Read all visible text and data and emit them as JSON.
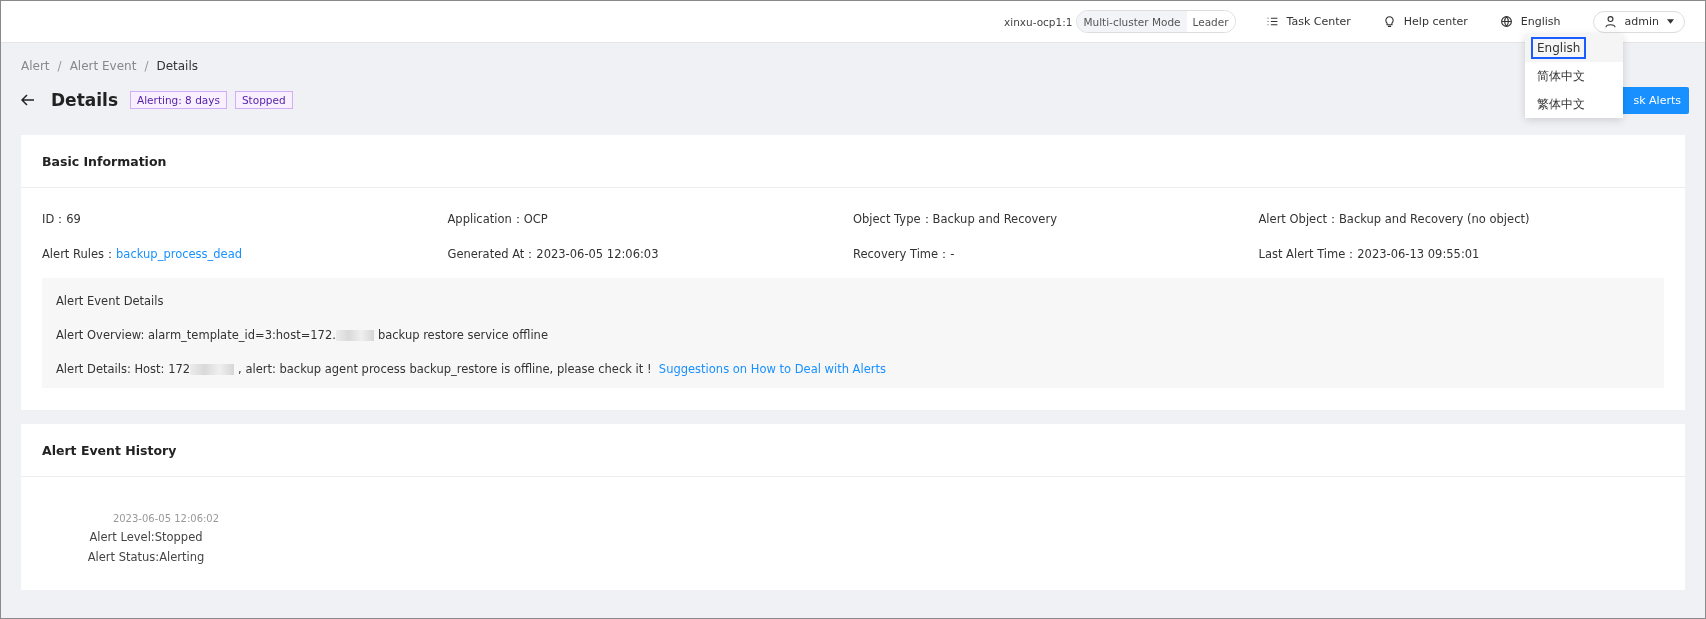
{
  "top_bar": {
    "cluster": "xinxu-ocp1:1",
    "mode": "Multi-cluster Mode",
    "role": "Leader",
    "task_center": "Task Center",
    "help_center": "Help center",
    "language": "English",
    "user": "admin"
  },
  "language_menu": [
    {
      "label": "English",
      "selected": true
    },
    {
      "label": "简体中文",
      "selected": false
    },
    {
      "label": "繁体中文",
      "selected": false
    }
  ],
  "breadcrumb_separator": "/",
  "breadcrumb": [
    {
      "label": "Alert",
      "current": false
    },
    {
      "label": "Alert Event",
      "current": false
    },
    {
      "label": "Details",
      "current": true
    }
  ],
  "page_title": "Details",
  "tags": [
    "Alerting: 8 days",
    "Stopped"
  ],
  "action_button": "sk Alerts",
  "basic_information": {
    "title": "Basic Information",
    "fields": [
      {
        "label": "ID：",
        "value": "69",
        "kind": "text"
      },
      {
        "label": "Application：",
        "value": "OCP",
        "kind": "text"
      },
      {
        "label": "Object Type：",
        "value": "Backup and Recovery",
        "kind": "text"
      },
      {
        "label": "Alert Object：",
        "value": "Backup and Recovery (no object)",
        "kind": "text"
      },
      {
        "label": "Alert Rules：",
        "value": "backup_process_dead",
        "kind": "link"
      },
      {
        "label": "Generated At：",
        "value": "2023-06-05 12:06:03",
        "kind": "text"
      },
      {
        "label": "Recovery Time：",
        "value": "-",
        "kind": "text"
      },
      {
        "label": "Last Alert Time：",
        "value": "2023-06-13 09:55:01",
        "kind": "text"
      }
    ],
    "event_details": {
      "title": "Alert Event Details",
      "overview": {
        "before": "Alert Overview: alarm_template_id=3:host=172.",
        "after": "backup restore service offline"
      },
      "details": {
        "before": "Alert Details: Host: 172",
        "after": ", alert: backup agent process backup_restore is offline, please check it !",
        "link": "Suggestions on How to Deal with Alerts"
      }
    }
  },
  "event_history": {
    "title": "Alert Event History",
    "entries": [
      {
        "time": "2023-06-05 12:06:02",
        "level": "Alert Level:Stopped",
        "status": "Alert Status:Alerting"
      }
    ]
  }
}
